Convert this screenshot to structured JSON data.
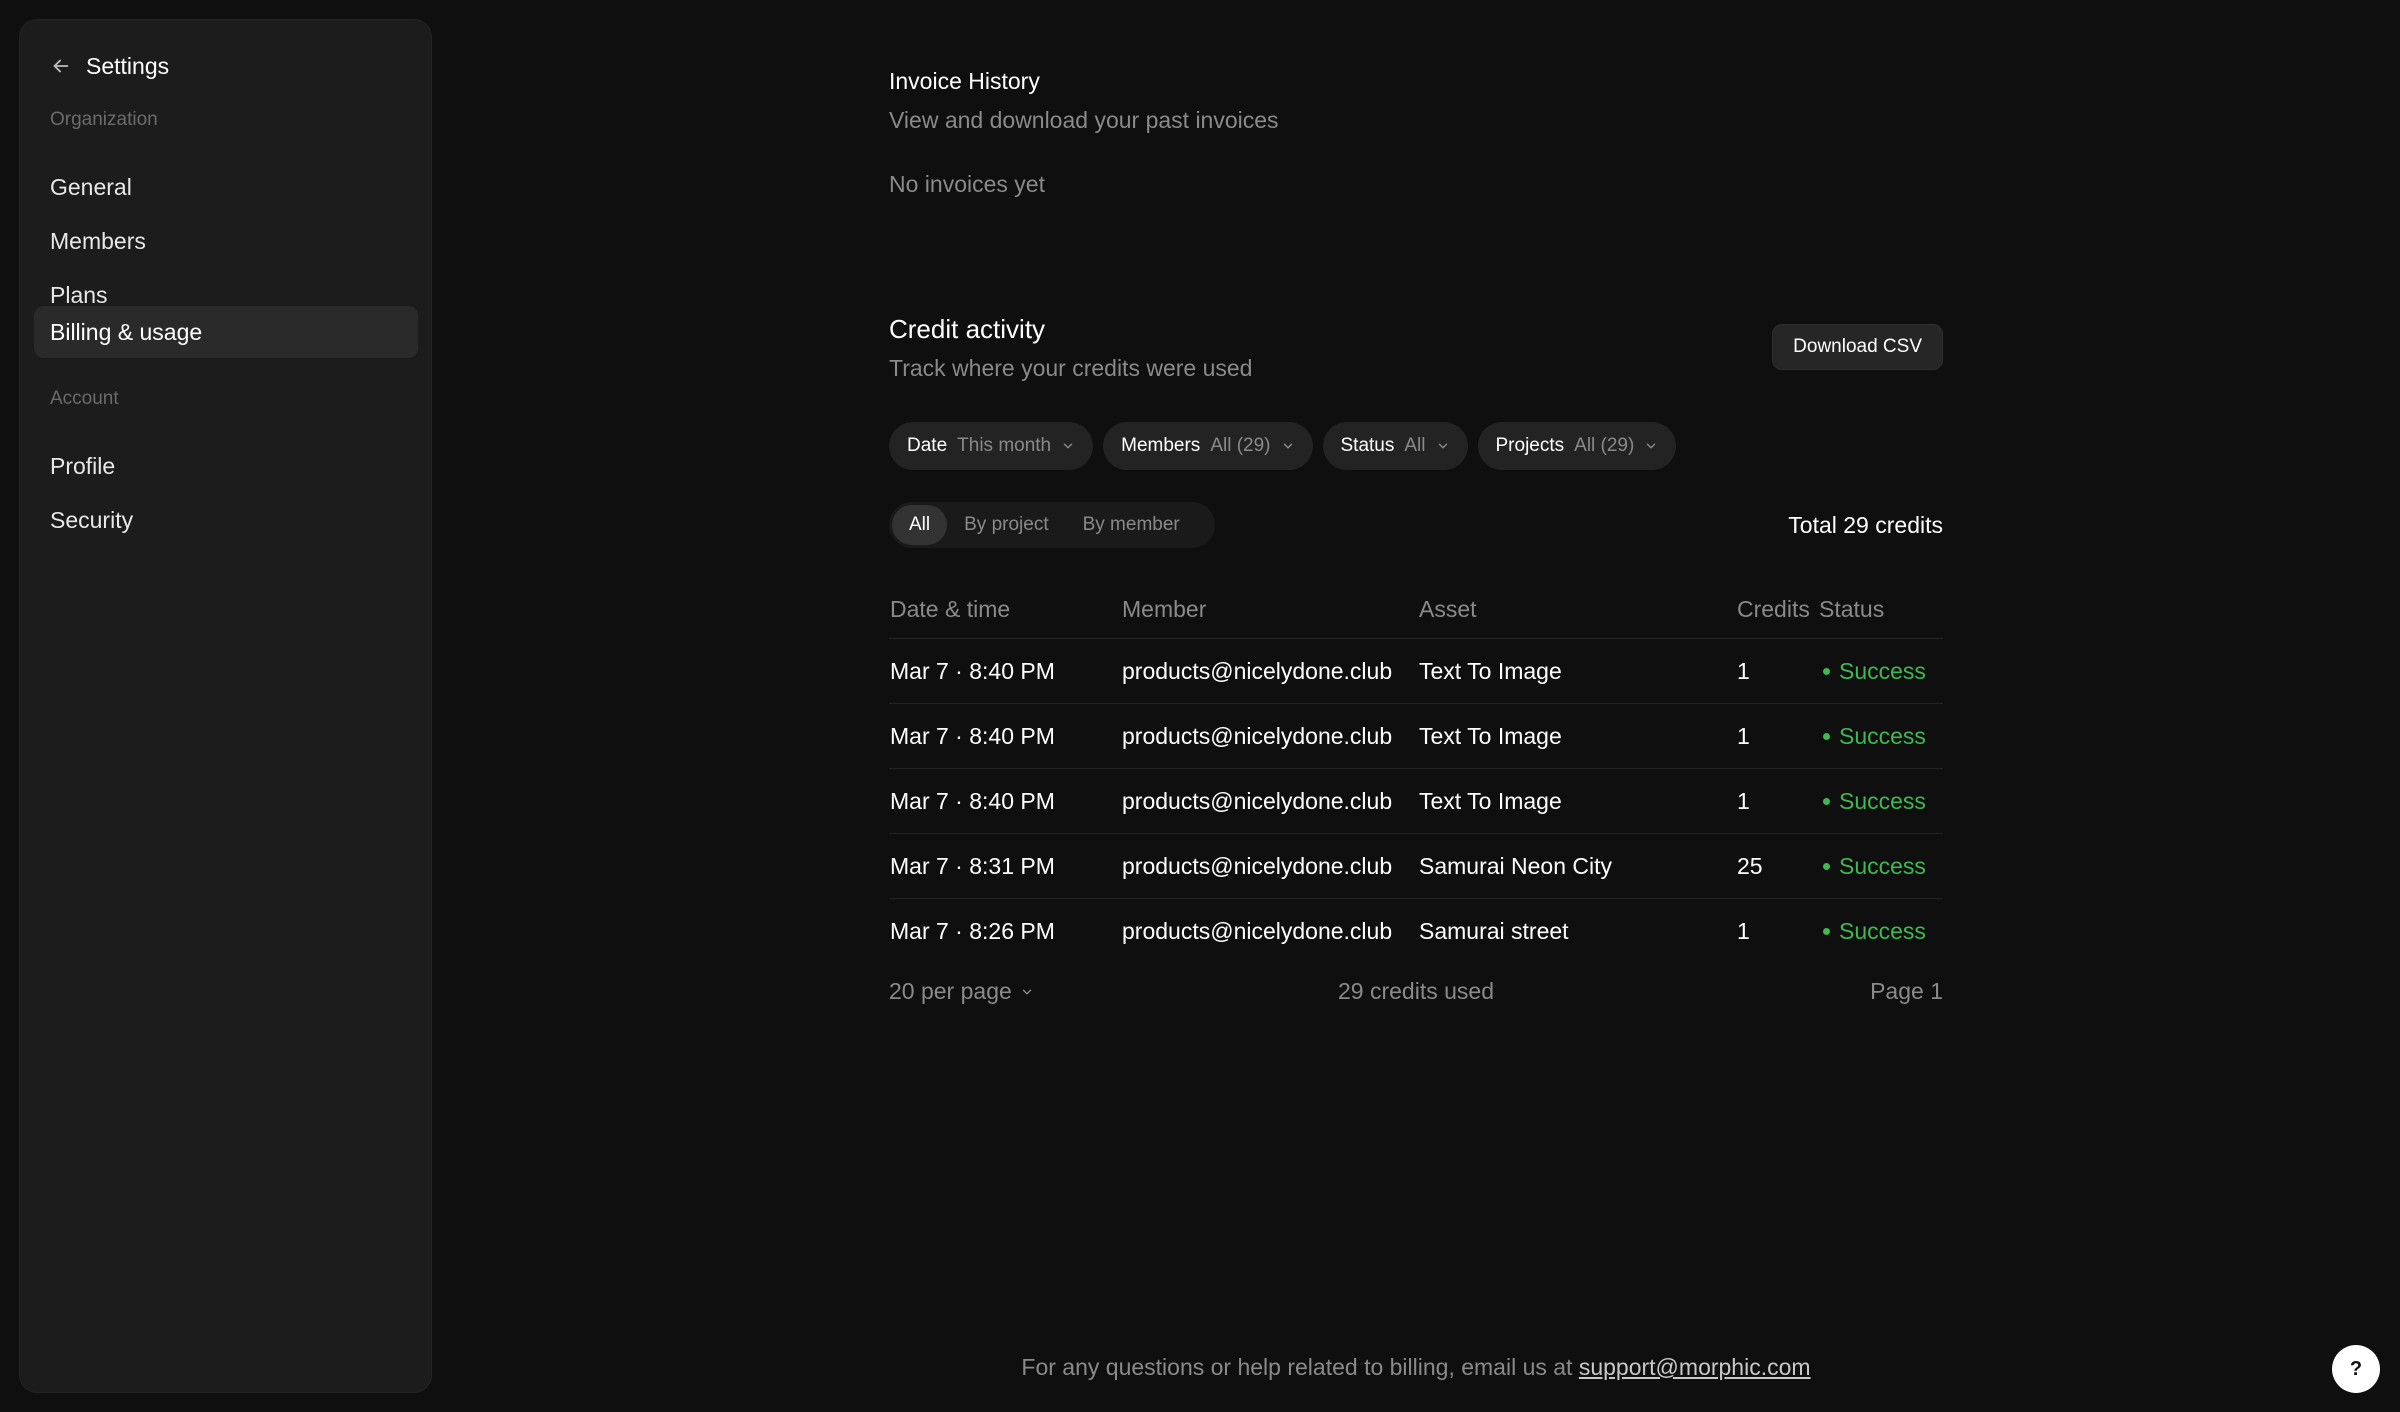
{
  "sidebar": {
    "title": "Settings",
    "sections": [
      {
        "label": "Organization"
      },
      {
        "label": "Account"
      }
    ],
    "items": [
      {
        "label": "General"
      },
      {
        "label": "Members"
      },
      {
        "label": "Plans"
      },
      {
        "label": "Billing & usage",
        "active": true
      },
      {
        "label": "Profile"
      },
      {
        "label": "Security"
      }
    ]
  },
  "invoices": {
    "title": "Invoice History",
    "subtitle": "View and download your past invoices",
    "empty": "No invoices yet"
  },
  "credits": {
    "title": "Credit activity",
    "subtitle": "Track where your credits were used",
    "download_label": "Download CSV",
    "filters": [
      {
        "key": "Date",
        "value": "This month"
      },
      {
        "key": "Members",
        "value": "All (29)"
      },
      {
        "key": "Status",
        "value": "All"
      },
      {
        "key": "Projects",
        "value": "All (29)"
      }
    ],
    "tabs": [
      {
        "label": "All",
        "active": true
      },
      {
        "label": "By project"
      },
      {
        "label": "By member"
      }
    ],
    "total": "Total 29 credits",
    "columns": [
      "Date & time",
      "Member",
      "Asset",
      "Credits",
      "Status"
    ],
    "rows": [
      {
        "date": "Mar 7 · 8:40 PM",
        "member": "products@nicelydone.club",
        "asset": "Text To Image",
        "credits": "1",
        "status": "Success"
      },
      {
        "date": "Mar 7 · 8:40 PM",
        "member": "products@nicelydone.club",
        "asset": "Text To Image",
        "credits": "1",
        "status": "Success"
      },
      {
        "date": "Mar 7 · 8:40 PM",
        "member": "products@nicelydone.club",
        "asset": "Text To Image",
        "credits": "1",
        "status": "Success"
      },
      {
        "date": "Mar 7 · 8:31 PM",
        "member": "products@nicelydone.club",
        "asset": "Samurai Neon City",
        "credits": "25",
        "status": "Success"
      },
      {
        "date": "Mar 7 · 8:26 PM",
        "member": "products@nicelydone.club",
        "asset": "Samurai street",
        "credits": "1",
        "status": "Success"
      }
    ],
    "per_page": "20 per page",
    "used": "29 credits used",
    "page": "Page 1"
  },
  "footer": {
    "text": "For any questions or help related to billing, email us at ",
    "email": "support@morphic.com"
  },
  "help_label": "?",
  "colors": {
    "background": "#0f0f0f",
    "sidebar": "#1c1c1c",
    "success": "#3fb950",
    "muted": "#8a8a8a"
  }
}
